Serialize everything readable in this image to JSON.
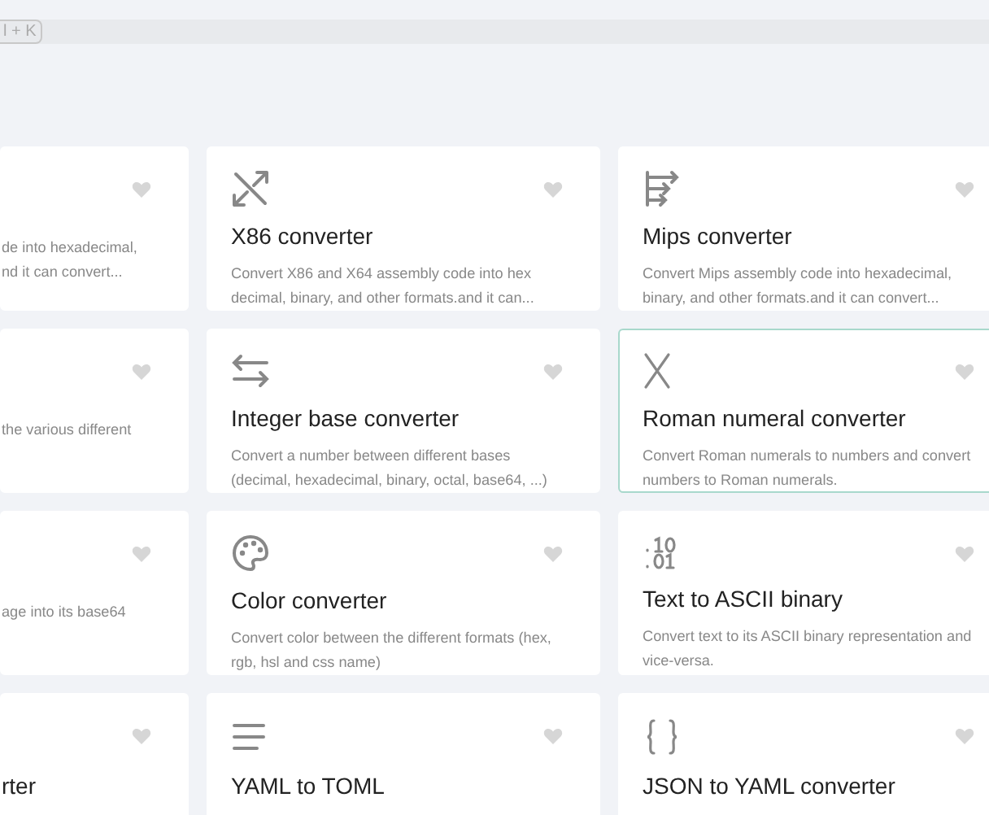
{
  "search_bar": {
    "shortcut": "l + K"
  },
  "cards": [
    {
      "kind": "partial",
      "lines": [
        "de into hexadecimal,",
        "nd it can convert..."
      ],
      "highlighted": false
    },
    {
      "kind": "diagonal-arrows",
      "title": "X86 converter",
      "lines": [
        "Convert X86 and X64 assembly code into hex",
        "decimal, binary, and other formats.and it can..."
      ],
      "highlighted": false
    },
    {
      "kind": "branch-arrows",
      "title": "Mips converter",
      "lines": [
        "Convert Mips assembly code into hexadecimal,",
        "binary, and other formats.and it can convert..."
      ],
      "highlighted": false
    },
    {
      "kind": "partial",
      "lines": [
        "the various different"
      ],
      "highlighted": false
    },
    {
      "kind": "swap",
      "title": "Integer base converter",
      "lines": [
        "Convert a number between different bases",
        "(decimal, hexadecimal, binary, octal, base64, ...)"
      ],
      "highlighted": false
    },
    {
      "kind": "letter-x",
      "title": "Roman numeral converter",
      "lines": [
        "Convert Roman numerals to numbers and convert",
        "numbers to Roman numerals."
      ],
      "highlighted": true
    },
    {
      "kind": "partial",
      "lines": [
        "age into its base64"
      ],
      "highlighted": false
    },
    {
      "kind": "palette",
      "title": "Color converter",
      "lines": [
        "Convert color between the different formats (hex,",
        "rgb, hsl and css name)"
      ],
      "highlighted": false
    },
    {
      "kind": "binary",
      "title": "Text to ASCII binary",
      "lines": [
        "Convert text to its ASCII binary representation and",
        "vice-versa."
      ],
      "highlighted": false
    },
    {
      "kind": "partial",
      "title": "rter",
      "highlighted": false
    },
    {
      "kind": "lines",
      "title": "YAML to TOML",
      "highlighted": false
    },
    {
      "kind": "braces",
      "title": "JSON to YAML converter",
      "highlighted": false
    }
  ]
}
